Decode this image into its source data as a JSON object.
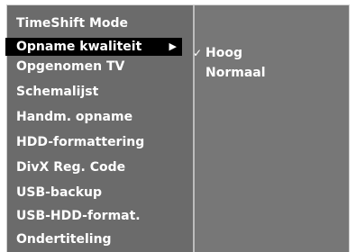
{
  "menu": {
    "items": [
      {
        "label": "TimeShift Mode"
      },
      {
        "label": "Opname kwaliteit",
        "selected": true,
        "has_submenu": true
      },
      {
        "label": "Opgenomen TV"
      },
      {
        "label": "Schemalijst"
      },
      {
        "label": "Handm. opname"
      },
      {
        "label": "HDD-formattering"
      },
      {
        "label": "DivX Reg. Code"
      },
      {
        "label": "USB-backup"
      },
      {
        "label": "USB-HDD-format."
      },
      {
        "label": "Ondertiteling"
      }
    ],
    "submenu_arrow_icon": "triangle-right-icon"
  },
  "submenu": {
    "options": [
      {
        "label": "Hoog",
        "checked": true
      },
      {
        "label": "Normaal",
        "checked": false
      }
    ],
    "check_icon": "checkmark-icon"
  },
  "colors": {
    "panel_left": "#6b6b6b",
    "panel_right": "#777777",
    "highlight": "#000000",
    "text": "#ffffff"
  }
}
